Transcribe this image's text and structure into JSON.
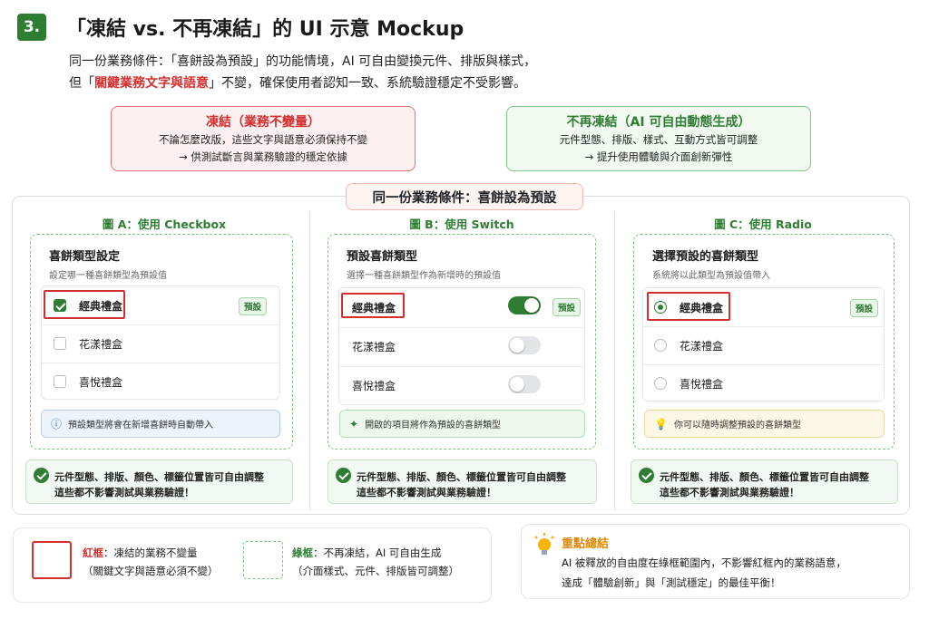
{
  "header": {
    "number": "3.",
    "title": "「凍結 vs. 不再凍結」的 UI 示意 Mockup"
  },
  "intro": {
    "line1": "同一份業務條件：「喜餅設為預設」的功能情境，AI 可自由變換元件、排版與樣式，",
    "line2_prefix": "但「",
    "line2_red": "關鍵業務文字與語意",
    "line2_suffix": "」不變，確保使用者認知一致、系統驗證穩定不受影響。"
  },
  "frozen": {
    "title": "凍結（業務不變量）",
    "line1": "不論怎麼改版，這些文字與語意必須保持不變",
    "line2": "→ 供測試斷言與業務驗證的穩定依據"
  },
  "unfrozen": {
    "title": "不再凍結（AI 可自由動態生成）",
    "line1": "元件型態、排版、樣式、互動方式皆可調整",
    "line2": "→ 提升使用體驗與介面創新彈性"
  },
  "condition": "同一份業務條件：喜餅設為預設",
  "colA": {
    "title": "圖 A：使用 Checkbox",
    "card_title": "喜餅類型設定",
    "card_sub": "設定哪一種喜餅類型為預設值",
    "options": [
      "經典禮盒",
      "花漾禮盒",
      "喜悅禮盒"
    ],
    "badge": "預設",
    "tip": "預設類型將會在新增喜餅時自動帶入"
  },
  "colB": {
    "title": "圖 B：使用 Switch",
    "card_title": "預設喜餅類型",
    "card_sub": "選擇一種喜餅類型作為新增時的預設值",
    "options": [
      "經典禮盒",
      "花漾禮盒",
      "喜悅禮盒"
    ],
    "badge": "預設",
    "tip": "開啟的項目將作為預設的喜餅類型"
  },
  "colC": {
    "title": "圖 C：使用 Radio",
    "card_title": "選擇預設的喜餅類型",
    "card_sub": "系統將以此類型為預設值帶入",
    "options": [
      "經典禮盒",
      "花漾禮盒",
      "喜悅禮盒"
    ],
    "badge": "預設",
    "tip": "你可以隨時調整預設的喜餅類型"
  },
  "ok_note": {
    "line1": "元件型態、排版、顏色、標籤位置皆可自由調整",
    "line2": "這些都不影響測試與業務驗證！"
  },
  "legend": {
    "red_label": "紅框",
    "red_text": "：凍結的業務不變量",
    "red_sub": "（關鍵文字與語意必須不變）",
    "green_label": "綠框",
    "green_text": "：不再凍結，AI 可自由生成",
    "green_sub": "（介面樣式、元件、排版皆可調整）"
  },
  "summary": {
    "title": "重點總結",
    "line1": "AI 被釋放的自由度在綠框範圍內，不影響紅框內的業務語意，",
    "line2": "達成「體驗創新」與「測試穩定」的最佳平衡！"
  },
  "colors": {
    "green": "#2e7d32",
    "red": "#d32f2f",
    "amber": "#e08a00"
  }
}
